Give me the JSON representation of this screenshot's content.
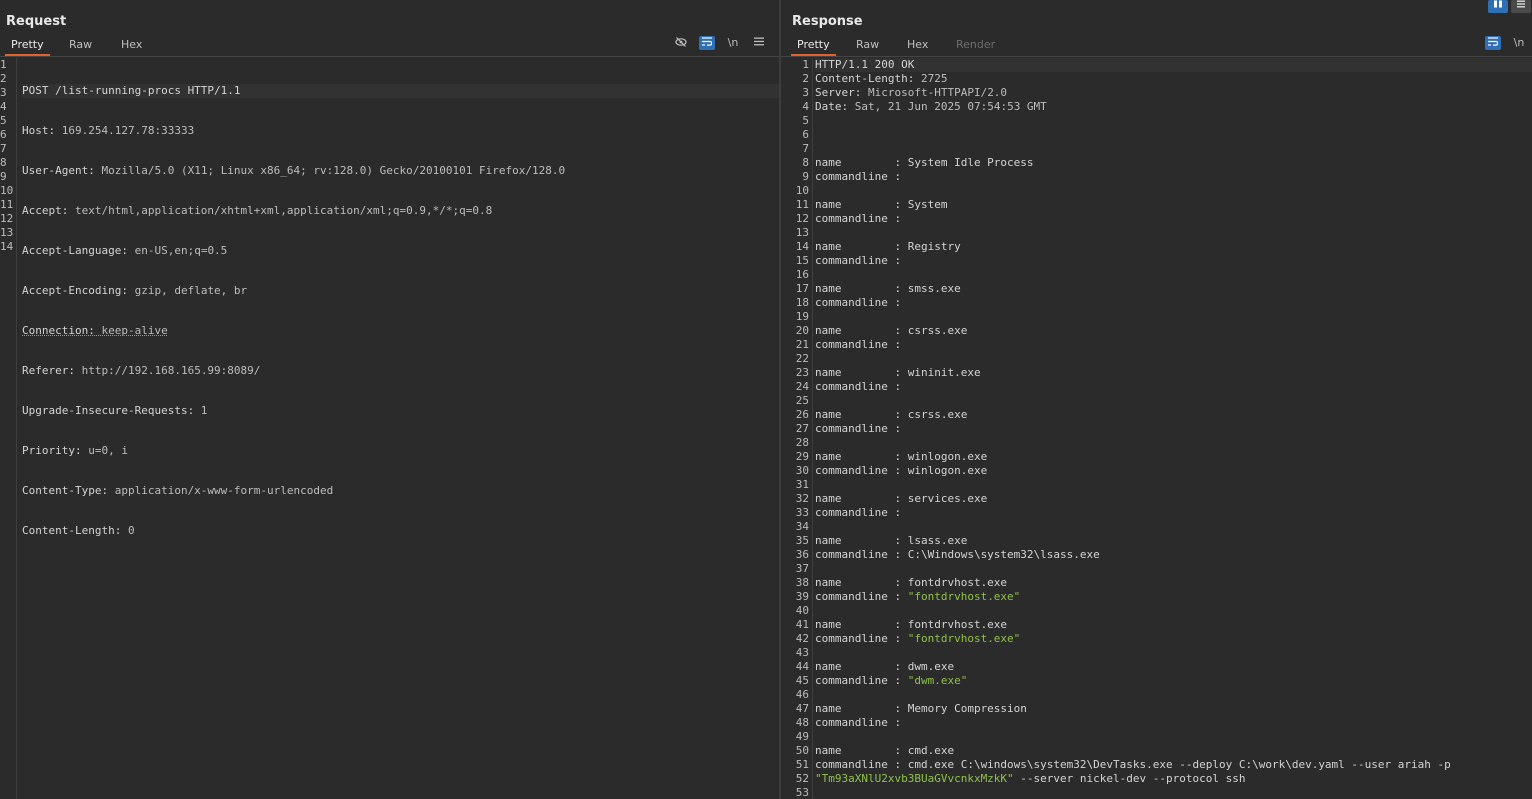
{
  "request": {
    "title": "Request",
    "tabs": [
      "Pretty",
      "Raw",
      "Hex"
    ],
    "active_tab": "Pretty",
    "toolbar": {
      "hide_icon": "eye-off-icon",
      "wrap_icon": "wrap-lines-icon",
      "newline_label": "\\n",
      "menu_icon": "hamburger-menu-icon"
    },
    "line_numbers": [
      "1",
      "2",
      "3",
      "4",
      "5",
      "6",
      "7",
      "8",
      "9",
      "10",
      "11",
      "12",
      "13",
      "14"
    ],
    "lines": [
      {
        "k": "POST /list-running-procs HTTP/1.1",
        "v": ""
      },
      {
        "k": "Host:",
        "v": " 169.254.127.78:33333"
      },
      {
        "k": "User-Agent:",
        "v": " Mozilla/5.0 (X11; Linux x86_64; rv:128.0) Gecko/20100101 Firefox/128.0"
      },
      {
        "k": "Accept:",
        "v": " text/html,application/xhtml+xml,application/xml;q=0.9,*/*;q=0.8"
      },
      {
        "k": "Accept-Language:",
        "v": " en-US,en;q=0.5"
      },
      {
        "k": "Accept-Encoding:",
        "v": " gzip, deflate, br"
      },
      {
        "k": "Connection:",
        "v": " keep-alive"
      },
      {
        "k": "Referer:",
        "v": " http://192.168.165.99:8089/"
      },
      {
        "k": "Upgrade-Insecure-Requests:",
        "v": " 1"
      },
      {
        "k": "Priority:",
        "v": " u=0, i"
      },
      {
        "k": "Content-Type:",
        "v": " application/x-www-form-urlencoded"
      },
      {
        "k": "Content-Length:",
        "v": " 0"
      },
      {
        "k": "",
        "v": ""
      },
      {
        "k": "",
        "v": ""
      }
    ]
  },
  "response": {
    "title": "Response",
    "tabs": [
      "Pretty",
      "Raw",
      "Hex",
      "Render"
    ],
    "active_tab": "Pretty",
    "toolbar": {
      "wrap_icon": "wrap-lines-icon",
      "newline_label": "\\n"
    },
    "line_numbers": [
      "1",
      "2",
      "3",
      "4",
      "5",
      "6",
      "7",
      "8",
      "9",
      "10",
      "11",
      "12",
      "13",
      "14",
      "15",
      "16",
      "17",
      "18",
      "19",
      "20",
      "21",
      "22",
      "23",
      "24",
      "25",
      "26",
      "27",
      "28",
      "29",
      "30",
      "31",
      "32",
      "33",
      "34",
      "35",
      "36",
      "37",
      "38",
      "39",
      "40",
      "41",
      "42",
      "43",
      "44",
      "45",
      "46",
      "47",
      "48",
      "49",
      "50",
      "51",
      "52",
      "53"
    ],
    "lines": [
      {
        "k": "HTTP/1.1 200 OK",
        "v": ""
      },
      {
        "k": "Content-Length:",
        "v": " 2725"
      },
      {
        "k": "Server:",
        "v": " Microsoft-HTTPAPI/2.0"
      },
      {
        "k": "Date:",
        "v": " Sat, 21 Jun 2025 07:54:53 GMT"
      },
      {
        "k": "",
        "v": ""
      },
      {
        "k": "",
        "v": ""
      },
      {
        "k": "",
        "v": ""
      },
      {
        "k": "name        : System Idle Process",
        "v": ""
      },
      {
        "k": "commandline :",
        "v": ""
      },
      {
        "k": "",
        "v": ""
      },
      {
        "k": "name        : System",
        "v": ""
      },
      {
        "k": "commandline :",
        "v": ""
      },
      {
        "k": "",
        "v": ""
      },
      {
        "k": "name        : Registry",
        "v": ""
      },
      {
        "k": "commandline :",
        "v": ""
      },
      {
        "k": "",
        "v": ""
      },
      {
        "k": "name        : smss.exe",
        "v": ""
      },
      {
        "k": "commandline :",
        "v": ""
      },
      {
        "k": "",
        "v": ""
      },
      {
        "k": "name        : csrss.exe",
        "v": ""
      },
      {
        "k": "commandline :",
        "v": ""
      },
      {
        "k": "",
        "v": ""
      },
      {
        "k": "name        : wininit.exe",
        "v": ""
      },
      {
        "k": "commandline :",
        "v": ""
      },
      {
        "k": "",
        "v": ""
      },
      {
        "k": "name        : csrss.exe",
        "v": ""
      },
      {
        "k": "commandline :",
        "v": ""
      },
      {
        "k": "",
        "v": ""
      },
      {
        "k": "name        : winlogon.exe",
        "v": ""
      },
      {
        "k": "commandline : winlogon.exe",
        "v": ""
      },
      {
        "k": "",
        "v": ""
      },
      {
        "k": "name        : services.exe",
        "v": ""
      },
      {
        "k": "commandline :",
        "v": ""
      },
      {
        "k": "",
        "v": ""
      },
      {
        "k": "name        : lsass.exe",
        "v": ""
      },
      {
        "k": "commandline : C:\\Windows\\system32\\lsass.exe",
        "v": ""
      },
      {
        "k": "",
        "v": ""
      },
      {
        "k": "name        : fontdrvhost.exe",
        "v": ""
      },
      {
        "k": "commandline : ",
        "s": "\"fontdrvhost.exe\""
      },
      {
        "k": "",
        "v": ""
      },
      {
        "k": "name        : fontdrvhost.exe",
        "v": ""
      },
      {
        "k": "commandline : ",
        "s": "\"fontdrvhost.exe\""
      },
      {
        "k": "",
        "v": ""
      },
      {
        "k": "name        : dwm.exe",
        "v": ""
      },
      {
        "k": "commandline : ",
        "s": "\"dwm.exe\""
      },
      {
        "k": "",
        "v": ""
      },
      {
        "k": "name        : Memory Compression",
        "v": ""
      },
      {
        "k": "commandline :",
        "v": ""
      },
      {
        "k": "",
        "v": ""
      },
      {
        "k": "name        : cmd.exe",
        "v": ""
      },
      {
        "k": "commandline : cmd.exe C:\\windows\\system32\\DevTasks.exe --deploy C:\\work\\dev.yaml --user ariah -p",
        "v": ""
      },
      {
        "s": "\"Tm93aXNlU2xvb3BUaGVvcnkxMzkK\"",
        "k2": " --server nickel-dev --protocol ssh"
      },
      {
        "k": "",
        "v": ""
      }
    ],
    "gutter_extra": [
      "51",
      "52"
    ]
  },
  "layout_buttons": {
    "split_icon": "split-view-icon",
    "menu_icon": "layout-menu-icon"
  },
  "colors": {
    "accent": "#e0632b",
    "string": "#8fc14a",
    "toolbar_active": "#2f6fb5"
  }
}
